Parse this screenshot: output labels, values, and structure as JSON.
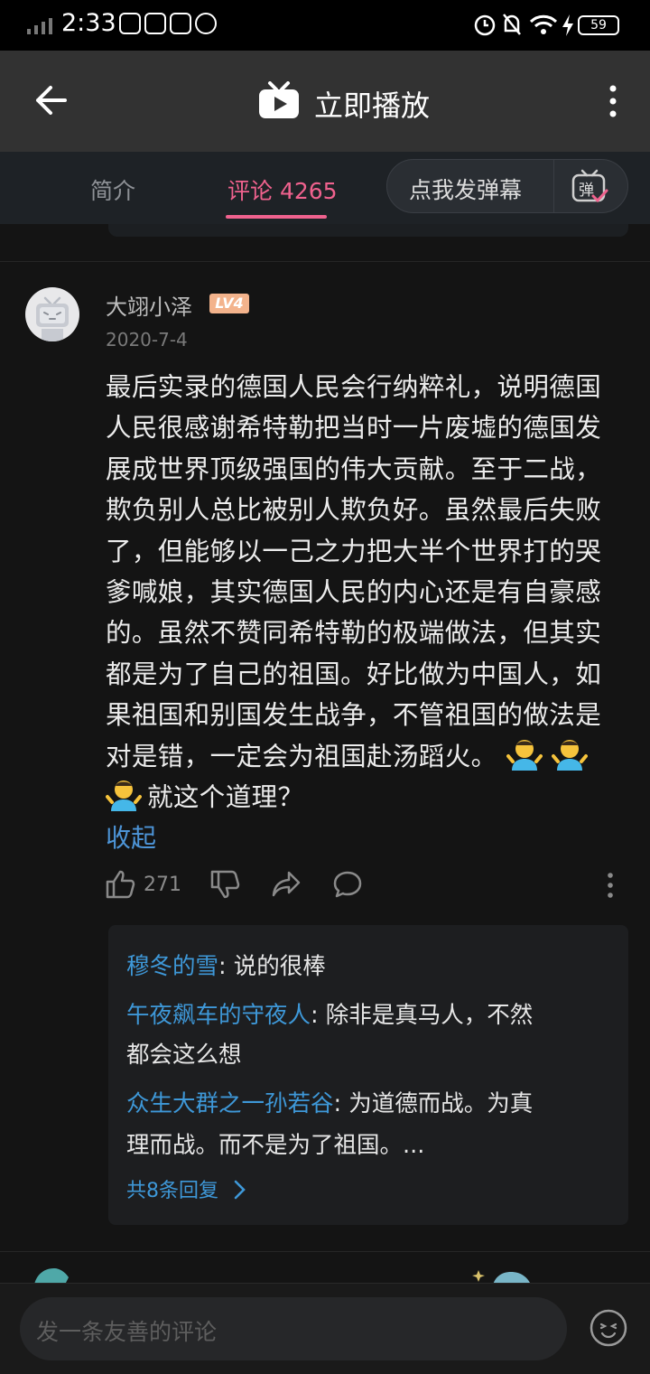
{
  "status_bar": {
    "time": "2:33",
    "battery": "59"
  },
  "header": {
    "title": "立即播放"
  },
  "tabs": [
    {
      "label": "简介"
    },
    {
      "label": "评论 4265"
    }
  ],
  "danmaku": {
    "label": "点我发弹幕",
    "icon_label": "弹"
  },
  "comment": {
    "username": "大翊小泽",
    "level": "LV4",
    "date": "2020-7-4",
    "lines": [
      "最后实录的德国人民会行纳粹礼，说明德国",
      "人民很感谢希特勒把当时一片废墟的德国发",
      "展成世界顶级强国的伟大贡献。至于二战，",
      "欺负别人总比被别人欺负好。虽然最后失败",
      "了，但能够以一己之力把大半个世界打的哭",
      "爹喊娘，其实德国人民的内心还是有自豪感",
      "的。虽然不赞同希特勒的极端做法，但其实",
      "都是为了自己的祖国。好比做为中国人，如",
      "果祖国和别国发生战争，不管祖国的做法是",
      "对是错，一定会为祖国赴汤蹈火。",
      "就这个道理？"
    ],
    "collapse_label": "收起",
    "like_count": "271"
  },
  "replies": [
    {
      "name": "穆冬的雪",
      "text": ": 说的很棒",
      "cont": ""
    },
    {
      "name": "午夜飙车的守夜人",
      "text": ": 除非是真马人，不然",
      "cont": "都会这么想"
    },
    {
      "name": "众生大群之一孙若谷",
      "text": ": 为道德而战。为真",
      "cont": "理而战。而不是为了祖国。..."
    }
  ],
  "more_replies": "共8条回复",
  "comment_input": {
    "placeholder": "发一条友善的评论"
  },
  "colors": {
    "accent": "#f0628e",
    "link": "#3e98d8",
    "background": "#141414"
  },
  "icons": [
    "back-arrow-icon",
    "tv-logo-icon",
    "more-vertical-icon",
    "danmaku-icon",
    "thumb-up-icon",
    "thumb-down-icon",
    "share-icon",
    "reply-icon",
    "emoji-icon",
    "chevron-right-icon"
  ]
}
